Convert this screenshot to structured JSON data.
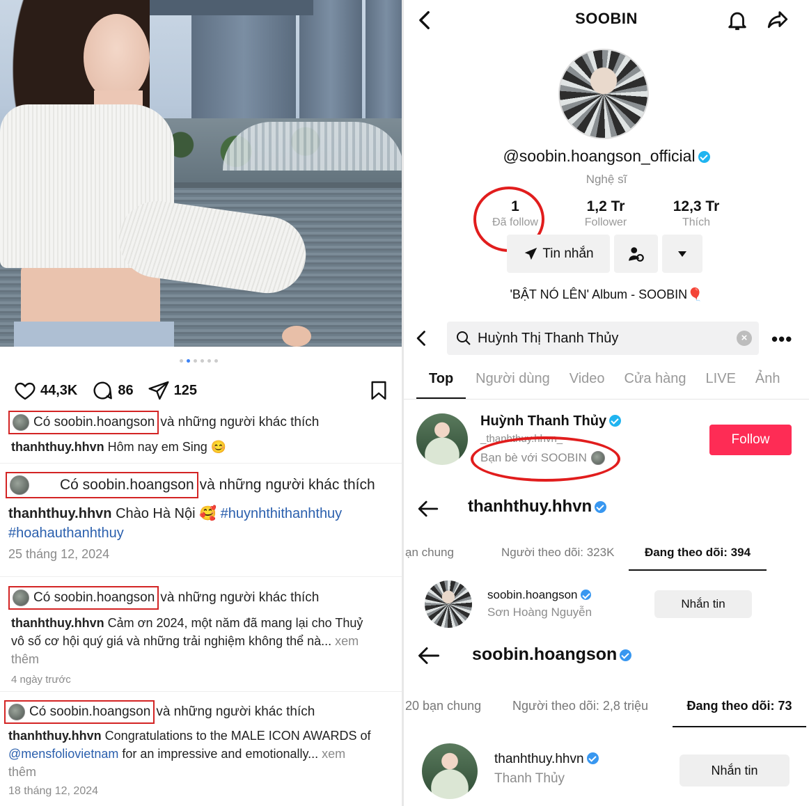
{
  "left": {
    "dots": 6,
    "actions": {
      "likes": "44,3K",
      "comments": "86",
      "shares": "125"
    },
    "posts": [
      {
        "like_user": "Có soobin.hoangson",
        "like_rest": "và những người khác thích",
        "author": "thanhthuy.hhvn",
        "caption": "Hôm nay em Sing 😊"
      },
      {
        "like_user": "Có soobin.hoangson",
        "like_rest": "và những người khác thích",
        "author": "thanhthuy.hhvn",
        "caption": "Chào Hà Nội 🥰",
        "tag1": "#huynhthithanhthuy",
        "tag2": "#hoahauthanhthuy",
        "date": "25 tháng 12, 2024"
      },
      {
        "like_user": "Có soobin.hoangson",
        "like_rest": "và những người khác thích",
        "author": "thanhthuy.hhvn",
        "caption": "Cảm ơn 2024, một năm đã mang lại cho Thuỷ",
        "caption2": "vô số cơ hội quý giá và những trải nghiệm không thể nà...",
        "more": "xem",
        "more2": "thêm",
        "date": "4 ngày trước"
      },
      {
        "like_user": "Có soobin.hoangson",
        "like_rest": "và những người khác thích",
        "author": "thanhthuy.hhvn",
        "caption": "Congratulations to the MALE ICON AWARDS of",
        "mention": "@mensfoliovietnam",
        "caption2": "for an impressive and emotionally...",
        "more": "xem",
        "more2": "thêm",
        "date": "18 tháng 12, 2024"
      }
    ]
  },
  "profile": {
    "title": "SOOBIN",
    "handle": "@soobin.hoangson_official",
    "role": "Nghệ sĩ",
    "stats": [
      {
        "n": "1",
        "l": "Đã follow"
      },
      {
        "n": "1,2 Tr",
        "l": "Follower"
      },
      {
        "n": "12,3 Tr",
        "l": "Thích"
      }
    ],
    "message_btn": "Tin nhắn",
    "bio": "'BẬT NÓ LÊN' Album - SOOBIN🎈"
  },
  "search": {
    "query": "Huỳnh Thị Thanh Thủy",
    "tabs": [
      "Top",
      "Người dùng",
      "Video",
      "Cửa hàng",
      "LIVE",
      "Ảnh"
    ],
    "result": {
      "name": "Huỳnh Thanh Thủy",
      "handle": "_thanhthuy.hhvn_",
      "friend": "Bạn bè với SOOBIN",
      "follow": "Follow"
    }
  },
  "ig1": {
    "title": "thanhthuy.hhvn",
    "tabs": [
      "ạn chung",
      "Người theo dõi: 323K",
      "Đang theo dõi: 394"
    ],
    "user": {
      "name": "soobin.hoangson",
      "full": "Sơn Hoàng Nguyễn",
      "btn": "Nhắn tin"
    }
  },
  "ig2": {
    "title": "soobin.hoangson",
    "tabs": [
      "20 bạn chung",
      "Người theo dõi: 2,8 triệu",
      "Đang theo dõi: 73"
    ],
    "user": {
      "name": "thanhthuy.hhvn",
      "full": "Thanh Thủy",
      "btn": "Nhắn tin"
    }
  },
  "colors": {
    "tiktok_red": "#fe2c55",
    "highlight_red": "#d32424",
    "verified": "#20b4f0",
    "ig_link": "#2a5fad"
  }
}
